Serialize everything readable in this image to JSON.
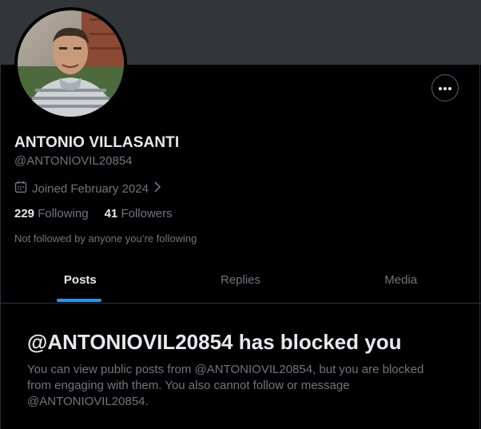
{
  "profile": {
    "name": "ANTONIO VILLASANTI",
    "handle": "@ANTONIOVIL20854",
    "joined": "Joined February 2024",
    "following_count": "229",
    "following_label": "Following",
    "followers_count": "41",
    "followers_label": "Followers",
    "not_followed": "Not followed by anyone you’re following"
  },
  "tabs": [
    {
      "label": "Posts",
      "active": true
    },
    {
      "label": "Replies",
      "active": false
    },
    {
      "label": "Media",
      "active": false
    }
  ],
  "blocked": {
    "title": "@ANTONIOVIL20854 has blocked you",
    "body": "You can view public posts from @ANTONIOVIL20854, but you are blocked from engaging with them. You also cannot follow or message @ANTONIOVIL20854."
  },
  "icons": {
    "more": "more-horizontal-icon",
    "calendar": "calendar-icon",
    "chevron": "chevron-right-icon"
  },
  "colors": {
    "background": "#000000",
    "banner": "#333639",
    "accent": "#1d9bf0",
    "text_primary": "#e7e9ea",
    "text_secondary": "#71767b"
  }
}
